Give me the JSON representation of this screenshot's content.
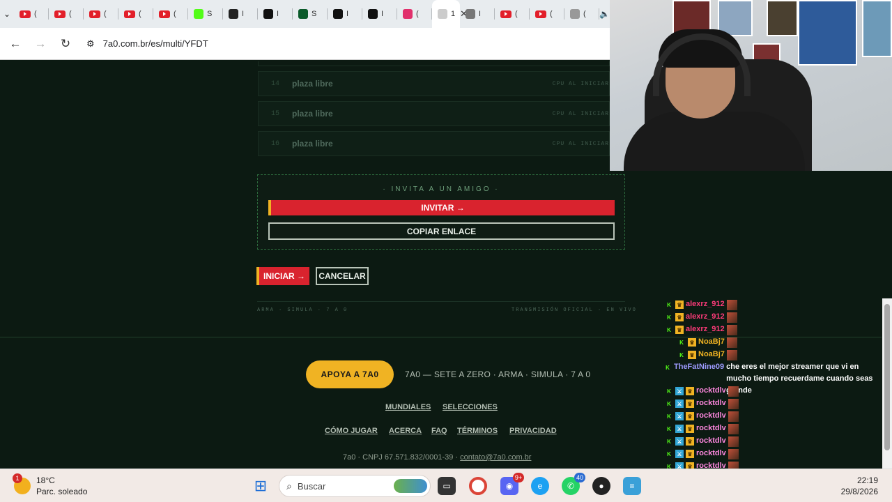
{
  "browser": {
    "tabs": [
      {
        "icon": "youtube-icon",
        "label": "("
      },
      {
        "icon": "youtube-icon",
        "label": "("
      },
      {
        "icon": "youtube-icon",
        "label": "("
      },
      {
        "icon": "youtube-icon",
        "label": "("
      },
      {
        "icon": "youtube-icon",
        "label": "("
      },
      {
        "icon": "kick-icon",
        "label": "S"
      },
      {
        "icon": "app-icon",
        "label": "I"
      },
      {
        "icon": "nb-icon",
        "label": "I"
      },
      {
        "icon": "grid-icon",
        "label": "S"
      },
      {
        "icon": "x-icon",
        "label": "I"
      },
      {
        "icon": "tiktok-icon",
        "label": "I"
      },
      {
        "icon": "instagram-icon",
        "label": "("
      },
      {
        "icon": "active-tab-icon",
        "label": "1"
      },
      {
        "icon": "chrome-icon",
        "label": "I"
      },
      {
        "icon": "youtube-icon",
        "label": "("
      },
      {
        "icon": "youtube-icon",
        "label": "("
      },
      {
        "icon": "audio-icon",
        "label": "("
      }
    ],
    "active_tab_close": "✕",
    "url": "7a0.com.br/es/multi/YFDT"
  },
  "lobby": {
    "slots": [
      {
        "num": "14",
        "name": "plaza libre",
        "status": "CPU AL INICIAR"
      },
      {
        "num": "15",
        "name": "plaza libre",
        "status": "CPU AL INICIAR"
      },
      {
        "num": "16",
        "name": "plaza libre",
        "status": "CPU AL INICIAR"
      }
    ]
  },
  "invite": {
    "title": "· INVITA A UN AMIGO ·",
    "invite_label": "INVITAR →",
    "copy_label": "COPIAR ENLACE"
  },
  "actions": {
    "start_label": "INICIAR →",
    "cancel_label": "CANCELAR"
  },
  "taglines": {
    "left": "ARMA · SIMULA · 7 A 0",
    "right": "TRANSMISIÓN OFICIAL · EN VIVO"
  },
  "footer": {
    "apoya_label": "APOYA A 7A0",
    "brand_line": "7A0 — SETE A ZERO · ARMA · SIMULA · 7 A 0",
    "links_row1": [
      "MUNDIALES",
      "SELECCIONES"
    ],
    "links_row2": [
      "CÓMO JUGAR",
      "ACERCA",
      "FAQ",
      "TÉRMINOS",
      "PRIVACIDAD"
    ],
    "legal_prefix": "7a0 · CNPJ 67.571.832/0001-39 · ",
    "legal_email": "contato@7a0.com.br"
  },
  "chat": {
    "messages": [
      {
        "user": "alexrz_912",
        "color": "#ff3b7a",
        "badges": [
          "K",
          "♛"
        ],
        "text": "",
        "indent": false
      },
      {
        "user": "alexrz_912",
        "color": "#ff3b7a",
        "badges": [
          "K",
          "♛"
        ],
        "text": "",
        "indent": false
      },
      {
        "user": "alexrz_912",
        "color": "#ff3b7a",
        "badges": [
          "K",
          "♛"
        ],
        "text": "",
        "indent": false
      },
      {
        "user": "NoaBj7",
        "color": "#f0b323",
        "badges": [
          "K",
          "♛"
        ],
        "text": "",
        "indent": true
      },
      {
        "user": "NoaBj7",
        "color": "#f0b323",
        "badges": [
          "K",
          "♛"
        ],
        "text": "",
        "indent": true
      },
      {
        "user": "TheFatNine09",
        "color": "#9e9bff",
        "badges": [
          "K"
        ],
        "text": "che eres el mejor streamer que vi en mucho tiempo recuerdame cuando seas grande",
        "indent": false
      },
      {
        "user": "rocktdlv",
        "color": "#ff88e0",
        "badges": [
          "K",
          "⚔",
          "♛"
        ],
        "text": "",
        "indent": false
      },
      {
        "user": "rocktdlv",
        "color": "#ff88e0",
        "badges": [
          "K",
          "⚔",
          "♛"
        ],
        "text": "",
        "indent": false
      },
      {
        "user": "rocktdlv",
        "color": "#ff88e0",
        "badges": [
          "K",
          "⚔",
          "♛"
        ],
        "text": "",
        "indent": false
      },
      {
        "user": "rocktdlv",
        "color": "#ff88e0",
        "badges": [
          "K",
          "⚔",
          "♛"
        ],
        "text": "",
        "indent": false
      },
      {
        "user": "rocktdlv",
        "color": "#ff88e0",
        "badges": [
          "K",
          "⚔",
          "♛"
        ],
        "text": "",
        "indent": false
      },
      {
        "user": "rocktdlv",
        "color": "#ff88e0",
        "badges": [
          "K",
          "⚔",
          "♛"
        ],
        "text": "",
        "indent": false
      },
      {
        "user": "rocktdlv",
        "color": "#ff88e0",
        "badges": [
          "K",
          "⚔",
          "♛"
        ],
        "text": "",
        "indent": false
      }
    ]
  },
  "taskbar": {
    "weather_badge": "1",
    "temperature": "18°C",
    "condition": "Parc. soleado",
    "search_placeholder": "Buscar",
    "discord_badge": "9+",
    "whatsapp_badge": "40",
    "time": "22:19",
    "date": "29/8/2026"
  },
  "colors": {
    "accent_red": "#d9232e",
    "accent_yellow": "#f0b323",
    "page_bg": "#0c1a12"
  }
}
